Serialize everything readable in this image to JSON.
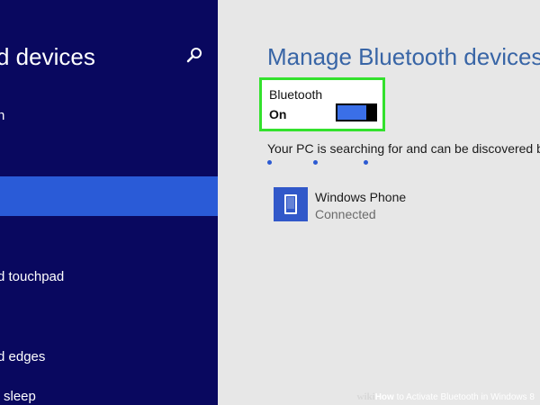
{
  "sidebar": {
    "title": "d devices",
    "items": [
      {
        "label": "n"
      },
      {
        "label": ""
      },
      {
        "label": "d touchpad"
      },
      {
        "label": "d edges"
      },
      {
        "label": "sleep"
      }
    ]
  },
  "main": {
    "title": "Manage Bluetooth devices",
    "bluetooth": {
      "label": "Bluetooth",
      "state": "On"
    },
    "status": "Your PC is searching for and can be discovered by Blue",
    "devices": [
      {
        "name": "Windows Phone",
        "status": "Connected"
      }
    ]
  },
  "watermark": {
    "prefix": "wiki",
    "how": "How",
    "rest": " to Activate Bluetooth in Windows 8"
  },
  "colors": {
    "sidebar_bg": "#09085f",
    "selected_bg": "#2a5bd7",
    "title_blue": "#3865a6",
    "highlight_green": "#33e12d",
    "toggle_blue": "#3a6fe8"
  }
}
